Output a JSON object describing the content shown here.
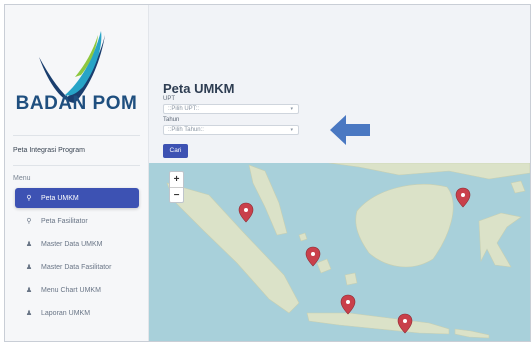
{
  "sidebar": {
    "brand": "BADAN POM",
    "program": "Peta Integrasi Program",
    "menu_label": "Menu",
    "items": [
      {
        "label": "Peta UMKM",
        "active": true,
        "icon": "map-marker-icon"
      },
      {
        "label": "Peta Fasilitator",
        "active": false,
        "icon": "map-marker-icon"
      },
      {
        "label": "Master Data UMKM",
        "active": false,
        "icon": "user-icon"
      },
      {
        "label": "Master Data Fasilitator",
        "active": false,
        "icon": "user-icon"
      },
      {
        "label": "Menu Chart UMKM",
        "active": false,
        "icon": "user-icon"
      },
      {
        "label": "Laporan UMKM",
        "active": false,
        "icon": "user-icon"
      }
    ]
  },
  "main": {
    "title": "Peta UMKM",
    "upt_label": "UPT",
    "upt_value": "::Pilih UPT::",
    "tahun_label": "Tahun",
    "tahun_value": "::Pilih Tahun::",
    "search_button": "Cari"
  },
  "map": {
    "zoom_in": "+",
    "zoom_out": "−",
    "markers": 6,
    "accent": "#3d52b3",
    "marker_color": "#c9404b",
    "sea_color": "#a8d0da",
    "land_color": "#dbe2c8"
  }
}
